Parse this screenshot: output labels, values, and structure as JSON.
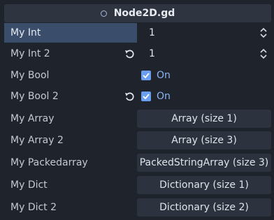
{
  "header": {
    "title": "Node2D.gd",
    "icon": "script-icon"
  },
  "properties": [
    {
      "label": "My Int",
      "editor": "spin",
      "value": "1",
      "revert": false,
      "selected": true
    },
    {
      "label": "My Int 2",
      "editor": "spin",
      "value": "1",
      "revert": true
    },
    {
      "label": "My Bool",
      "editor": "bool",
      "value": "On",
      "checked": true,
      "revert": false
    },
    {
      "label": "My Bool 2",
      "editor": "bool",
      "value": "On",
      "checked": true,
      "revert": true
    },
    {
      "label": "My Array",
      "editor": "button",
      "value": "Array (size 1)"
    },
    {
      "label": "My Array 2",
      "editor": "button",
      "value": "Array (size 3)"
    },
    {
      "label": "My Packedarray",
      "editor": "button",
      "value": "PackedStringArray (size 3)"
    },
    {
      "label": "My Dict",
      "editor": "button",
      "value": "Dictionary (size 1)"
    },
    {
      "label": "My Dict 2",
      "editor": "button",
      "value": "Dictionary (size 2)"
    }
  ],
  "colors": {
    "accent": "#6a9ef0",
    "selected_row": "#3a4d6a",
    "on_text": "#8ab4f4"
  }
}
